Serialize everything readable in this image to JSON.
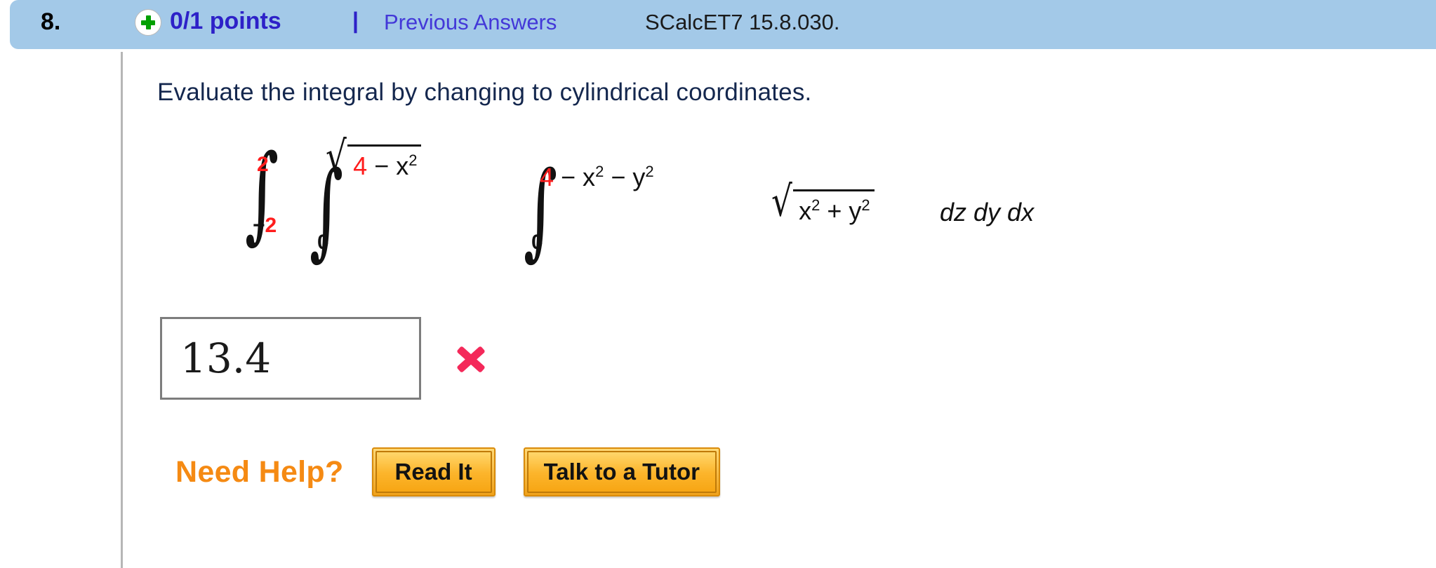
{
  "header": {
    "question_number": "8.",
    "plus_icon": "plus-circle-icon",
    "points": "0/1 points",
    "separator": "|",
    "previous_answers": "Previous Answers",
    "problem_code": "SCalcET7 15.8.030.",
    "bar_color": "#a3c9e8",
    "points_color": "#2d21c8",
    "link_color": "#4338d8"
  },
  "question": {
    "prompt": "Evaluate the integral by changing to cylindrical coordinates."
  },
  "math": {
    "integral_1": {
      "symbol": "∫",
      "upper": "2",
      "lower": "−2",
      "upper_color": "#ff1d1d",
      "lower_color": "#ff1d1d"
    },
    "integral_2": {
      "symbol": "∫",
      "upper_radical": "√",
      "upper_inner_number": "4",
      "upper_inner_rest": " − x",
      "upper_inner_exp": "2",
      "lower": "0"
    },
    "integral_3": {
      "symbol": "∫",
      "upper_number": "4",
      "upper_rest_a": " − x",
      "upper_exp_a": "2",
      "upper_rest_b": " − y",
      "upper_exp_b": "2",
      "lower": "0"
    },
    "integrand": {
      "radical": "√",
      "base_a": "x",
      "exp_a": "2",
      "plus": " + ",
      "base_b": "y",
      "exp_b": "2"
    },
    "differentials": "dz dy dx",
    "limit_red": "#ff1d1d"
  },
  "answer": {
    "value": "13.4",
    "status_icon": "wrong-x-icon",
    "status_color": "#f4295a"
  },
  "help": {
    "label": "Need Help?",
    "label_color": "#f58a13",
    "buttons": [
      {
        "label": "Read It"
      },
      {
        "label": "Talk to a Tutor"
      }
    ]
  }
}
